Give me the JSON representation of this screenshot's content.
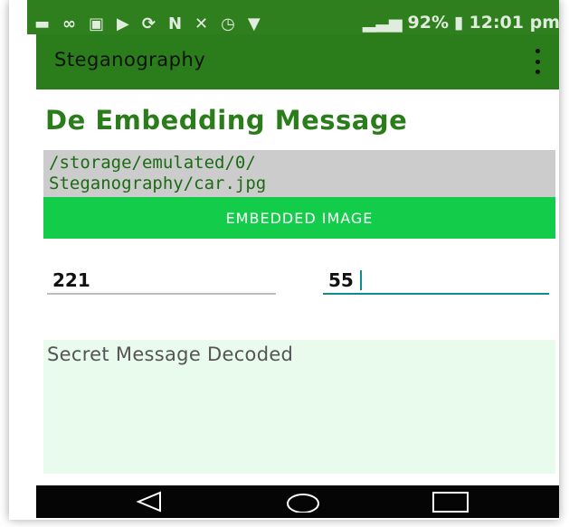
{
  "status_bar": {
    "battery_text": "92%",
    "time": "12:01 pm",
    "icons": [
      "message-icon",
      "voicemail-icon",
      "image-icon",
      "play-icon",
      "sync-icon",
      "nfc-icon",
      "mute-icon",
      "alarm-icon",
      "wifi-icon",
      "signal-icon",
      "battery-icon"
    ]
  },
  "action_bar": {
    "title": "Steganography",
    "overflow_icon": "more-vert-icon"
  },
  "page": {
    "title": "De Embedding Message",
    "path_line1": "/storage/emulated/0/",
    "path_line2": "Steganography/car.jpg",
    "button_label": "EMBEDDED IMAGE",
    "field1_value": "221",
    "field2_value": "55",
    "decoded_placeholder": "Secret Message Decoded"
  },
  "nav_bar": {
    "back_icon": "back-triangle-icon",
    "home_icon": "home-circle-icon",
    "recent_icon": "recents-square-icon"
  },
  "colors": {
    "app_green": "#2a7d1a",
    "button_green": "#12cc4a",
    "path_bg": "#cccccc",
    "decoded_bg": "#e9fbec",
    "focus_teal": "#0f8c8c"
  }
}
